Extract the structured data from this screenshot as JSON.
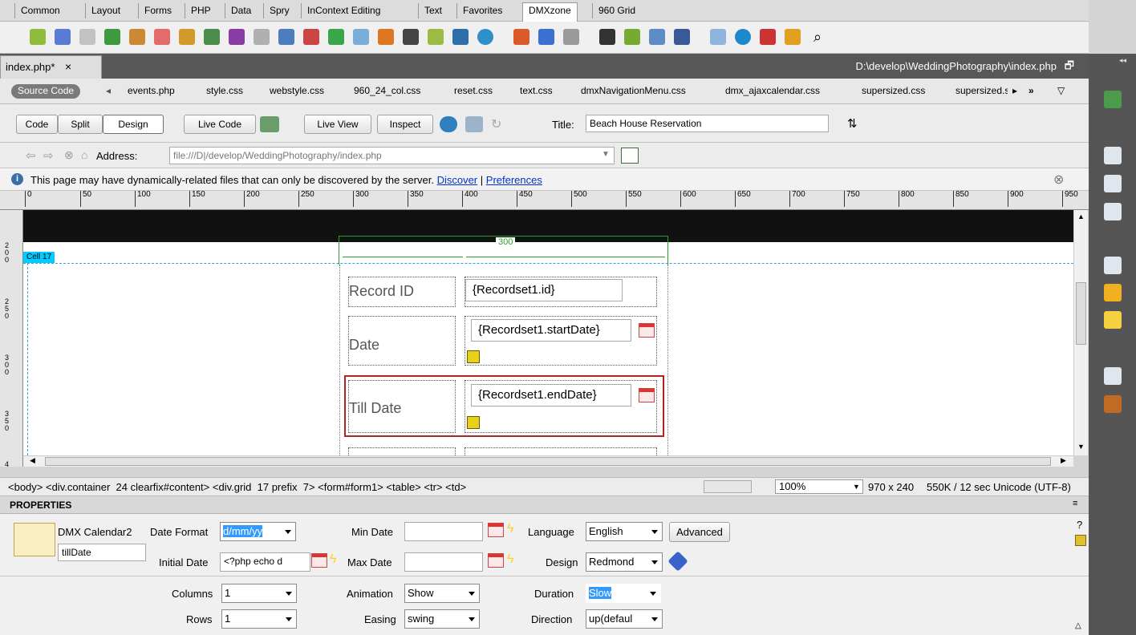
{
  "category_tabs": [
    "Common",
    "Layout",
    "Forms",
    "PHP",
    "Data",
    "Spry",
    "InContext Editing",
    "Text",
    "Favorites",
    "DMXzone",
    "960 Grid"
  ],
  "active_category": "DMXzone",
  "document": {
    "tab_label": "index.php*",
    "close": "×",
    "path": "D:\\develop\\WeddingPhotography\\index.php"
  },
  "related_files": {
    "source_code": "Source Code",
    "files": [
      "events.php",
      "style.css",
      "webstyle.css",
      "960_24_col.css",
      "reset.css",
      "text.css",
      "dmxNavigationMenu.css",
      "dmx_ajaxcalendar.css",
      "supersized.css",
      "supersized.s"
    ]
  },
  "toolbar": {
    "code": "Code",
    "split": "Split",
    "design": "Design",
    "live_code": "Live Code",
    "live_view": "Live View",
    "inspect": "Inspect",
    "title_label": "Title:",
    "title_value": "Beach House Reservation"
  },
  "address": {
    "label": "Address:",
    "value": "file:///D|/develop/WeddingPhotography/index.php"
  },
  "info": {
    "message": "This page may have dynamically-related files that can only be discovered by the server.",
    "discover": "Discover",
    "separator": "|",
    "preferences": "Preferences"
  },
  "ruler_ticks": [
    "0",
    "50",
    "100",
    "150",
    "200",
    "250",
    "300",
    "350",
    "400",
    "450",
    "500",
    "550",
    "600",
    "650",
    "700",
    "750",
    "800",
    "850",
    "900",
    "950"
  ],
  "vruler_labels": [
    "200",
    "250",
    "300",
    "350",
    "4"
  ],
  "canvas": {
    "cell_label": "Cell 17",
    "width_label": "300",
    "rows": [
      {
        "label": "Record ID",
        "value": "{Recordset1.id}"
      },
      {
        "label": "Date",
        "value": "{Recordset1.startDate}"
      },
      {
        "label": "Till Date",
        "value": "{Recordset1.endDate}"
      }
    ]
  },
  "status": {
    "tag_path": "<body> <div.container  24 clearfix#content> <div.grid  17 prefix  7> <form#form1> <table> <tr> <td>",
    "zoom": "100%",
    "window_size": "970 x 240",
    "download": "550K / 12 sec",
    "encoding": "Unicode (UTF-8)"
  },
  "properties": {
    "title": "PROPERTIES",
    "component": "DMX Calendar2",
    "id_value": "tillDate",
    "date_format_label": "Date Format",
    "date_format_value": "d/mm/yy",
    "initial_date_label": "Initial Date",
    "initial_date_value": "<?php echo d",
    "min_date_label": "Min Date",
    "max_date_label": "Max Date",
    "language_label": "Language",
    "language_value": "English",
    "advanced": "Advanced",
    "design_label": "Design",
    "design_value": "Redmond",
    "columns_label": "Columns",
    "columns_value": "1",
    "rows_label": "Rows",
    "rows_value": "1",
    "animation_label": "Animation",
    "animation_value": "Show",
    "easing_label": "Easing",
    "easing_value": "swing",
    "duration_label": "Duration",
    "duration_value": "Slow",
    "direction_label": "Direction",
    "direction_value": "up(defaul",
    "help": "?"
  },
  "colors": {
    "accent_red": "#b22222",
    "selection_blue": "#3399ff",
    "guide_green": "#2ca02c",
    "cell_label_bg": "#00ccff"
  }
}
